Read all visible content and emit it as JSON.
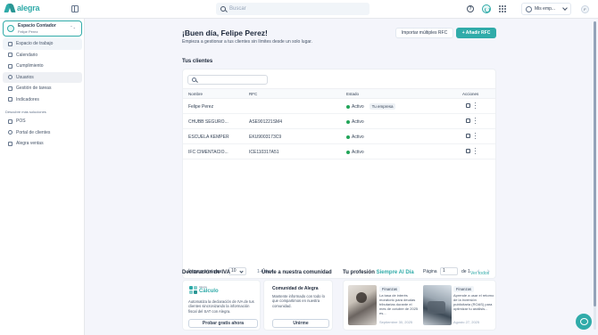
{
  "topbar": {
    "logo": "alegra",
    "search_placeholder": "Buscar",
    "help_glyph": "?",
    "company_label": "Mis emp...",
    "user_initial": "F"
  },
  "sidebar": {
    "account": {
      "name": "Espacio Contador",
      "user": "Felipe Perez",
      "sort_glyph": "⌃⌄"
    },
    "items": [
      {
        "label": "Espacio de trabajo",
        "icon": "briefcase-icon"
      },
      {
        "label": "Calendario",
        "icon": "calendar-icon"
      },
      {
        "label": "Cumplimiento",
        "icon": "checklist-icon"
      },
      {
        "label": "Usuarios",
        "icon": "user-icon"
      },
      {
        "label": "Gestión de tareas",
        "icon": "tasks-icon"
      },
      {
        "label": "Indicadores",
        "icon": "chart-icon"
      }
    ],
    "section_label": "Descubre más soluciones",
    "extra_items": [
      {
        "label": "POS",
        "icon": "pos-icon"
      },
      {
        "label": "Portal de clientes",
        "icon": "portal-icon"
      },
      {
        "label": "Alegra ventas",
        "icon": "sales-icon"
      }
    ]
  },
  "main": {
    "greeting": "¡Buen día, Felipe Perez!",
    "subtitle": "Empieza a gestionar a tus clientes sin límites desde un solo lugar.",
    "import_button": "Importar múltiples RFC",
    "add_button": "+ Añadir RFC",
    "clients_title": "Tus clientes",
    "table": {
      "headers": [
        "Nombre",
        "RFC",
        "Estado",
        "Acciones"
      ],
      "rows": [
        {
          "name": "Felipe Perez",
          "rfc": "",
          "status": "Activo",
          "tag": "Tu empresa"
        },
        {
          "name": "CHUBB SEGURO...",
          "rfc": "ASE901221SM4",
          "status": "Activo",
          "tag": ""
        },
        {
          "name": "ESCUELA KEMPER",
          "rfc": "EKU9003173C9",
          "status": "Activo",
          "tag": ""
        },
        {
          "name": "IFC CIMENTACIO...",
          "rfc": "ICE110317A51",
          "status": "Activo",
          "tag": ""
        }
      ]
    },
    "pager": {
      "per_page_label": "Ítems por página:",
      "per_page_value": "10",
      "range": "1-4 de 4",
      "page_label": "Página",
      "page_value": "1",
      "page_of": "de 1"
    }
  },
  "bottom": {
    "iva": {
      "title": "Declaración de IVA",
      "logo_small": "Alegra",
      "logo_big": "Cálculo",
      "desc": "Automatiza la declaración de IVA de tus clientes sincronizando la información fiscal del SAT con Alegra.",
      "button": "Probar gratis ahora"
    },
    "community": {
      "title": "Únete a nuestra comunidad",
      "heading": "Comunidad de Alegra",
      "desc": "Mantente informado con todo lo que compartimos en nuestra comunidad.",
      "button": "Unirme"
    },
    "profession": {
      "title": "Tu profesión",
      "title_accent": "Siempre Al Día",
      "see_all": "Ver todos",
      "articles": [
        {
          "tag": "Finanzas",
          "text": "La tasa de interés moratorio para deudas tributarias durante el mes de octubre de 2025 es...",
          "date": "Septiembre 30, 2025"
        },
        {
          "tag": "Finanzas",
          "text": "Aprende a usar el retorno de la inversión publicitaria (ROAS) para optimizar tu análisis...",
          "date": "Agosto 27, 2025"
        }
      ]
    }
  },
  "colors": {
    "brand": "#30aba9",
    "active": "#22a559"
  }
}
